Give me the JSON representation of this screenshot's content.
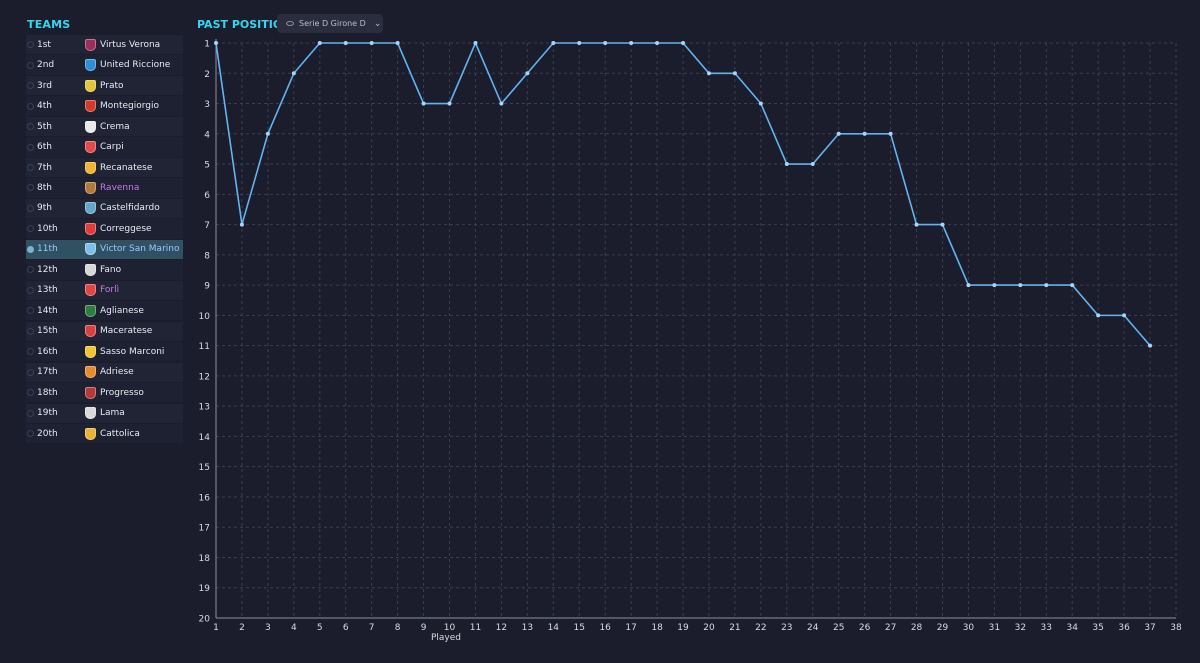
{
  "teams_panel": {
    "heading": "TEAMS",
    "rows": [
      {
        "pos": "1st",
        "name": "Virtus Verona",
        "crest": "#9c2d5c",
        "state": "normal"
      },
      {
        "pos": "2nd",
        "name": "United Riccione",
        "crest": "#2f8fd6",
        "state": "normal"
      },
      {
        "pos": "3rd",
        "name": "Prato",
        "crest": "#e2c53a",
        "state": "normal"
      },
      {
        "pos": "4th",
        "name": "Montegiorgio",
        "crest": "#d23a2a",
        "state": "normal"
      },
      {
        "pos": "5th",
        "name": "Crema",
        "crest": "#e9e9e9",
        "state": "normal"
      },
      {
        "pos": "6th",
        "name": "Carpi",
        "crest": "#e34b4b",
        "state": "normal"
      },
      {
        "pos": "7th",
        "name": "Recanatese",
        "crest": "#f2b233",
        "state": "normal"
      },
      {
        "pos": "8th",
        "name": "Ravenna",
        "crest": "#b07a3b",
        "state": "purple"
      },
      {
        "pos": "9th",
        "name": "Castelfidardo",
        "crest": "#62a6c8",
        "state": "normal"
      },
      {
        "pos": "10th",
        "name": "Correggese",
        "crest": "#e23b3b",
        "state": "normal"
      },
      {
        "pos": "11th",
        "name": "Victor San Marino",
        "crest": "#7fc0e8",
        "state": "selected"
      },
      {
        "pos": "12th",
        "name": "Fano",
        "crest": "#d7d7d7",
        "state": "normal"
      },
      {
        "pos": "13th",
        "name": "Forlì",
        "crest": "#e04646",
        "state": "purple"
      },
      {
        "pos": "14th",
        "name": "Aglianese",
        "crest": "#2e7d3e",
        "state": "normal"
      },
      {
        "pos": "15th",
        "name": "Maceratese",
        "crest": "#d94040",
        "state": "normal"
      },
      {
        "pos": "16th",
        "name": "Sasso Marconi",
        "crest": "#f1c531",
        "state": "normal"
      },
      {
        "pos": "17th",
        "name": "Adriese",
        "crest": "#e58a2e",
        "state": "normal"
      },
      {
        "pos": "18th",
        "name": "Progresso",
        "crest": "#b43a3a",
        "state": "normal"
      },
      {
        "pos": "19th",
        "name": "Lama",
        "crest": "#dadada",
        "state": "normal"
      },
      {
        "pos": "20th",
        "name": "Cattolica",
        "crest": "#e7b533",
        "state": "normal"
      }
    ]
  },
  "chart_header": {
    "heading": "PAST POSITIONS",
    "league_select": "Serie D Girone D",
    "icons": {
      "select_icon": "eye-icon",
      "dropdown": "chevron-down-icon"
    }
  },
  "chart_data": {
    "type": "line",
    "xlabel": "Played",
    "ylabel": "",
    "xlim": [
      1,
      38
    ],
    "ylim": [
      1,
      20
    ],
    "y_inverted": true,
    "grid": true,
    "line_color": "#62b4ee",
    "x_ticks": [
      1,
      2,
      3,
      4,
      5,
      6,
      7,
      8,
      9,
      10,
      11,
      12,
      13,
      14,
      15,
      16,
      17,
      18,
      19,
      20,
      21,
      22,
      23,
      24,
      25,
      26,
      27,
      28,
      29,
      30,
      31,
      32,
      33,
      34,
      35,
      36,
      37,
      38
    ],
    "y_ticks": [
      1,
      2,
      3,
      4,
      5,
      6,
      7,
      8,
      9,
      10,
      11,
      12,
      13,
      14,
      15,
      16,
      17,
      18,
      19,
      20
    ],
    "series": [
      {
        "x": [
          1,
          2,
          3,
          4,
          5,
          6,
          7,
          8,
          9,
          10,
          11,
          12,
          13,
          14,
          15,
          16,
          17,
          18,
          19,
          20,
          21,
          22,
          23,
          24,
          25,
          26,
          27,
          28,
          29,
          30,
          31,
          32,
          33,
          34,
          35,
          36,
          37
        ],
        "y": [
          1,
          7,
          4,
          2,
          1,
          1,
          1,
          1,
          3,
          3,
          1,
          3,
          2,
          1,
          1,
          1,
          1,
          1,
          1,
          2,
          2,
          3,
          5,
          5,
          4,
          4,
          4,
          7,
          7,
          9,
          9,
          9,
          9,
          9,
          10,
          10,
          11
        ]
      }
    ]
  },
  "colors": {
    "accent": "#31d7f2",
    "background": "#1b1d2c",
    "selected_row": "#2f5162",
    "highlight_text": "#c37be5"
  }
}
